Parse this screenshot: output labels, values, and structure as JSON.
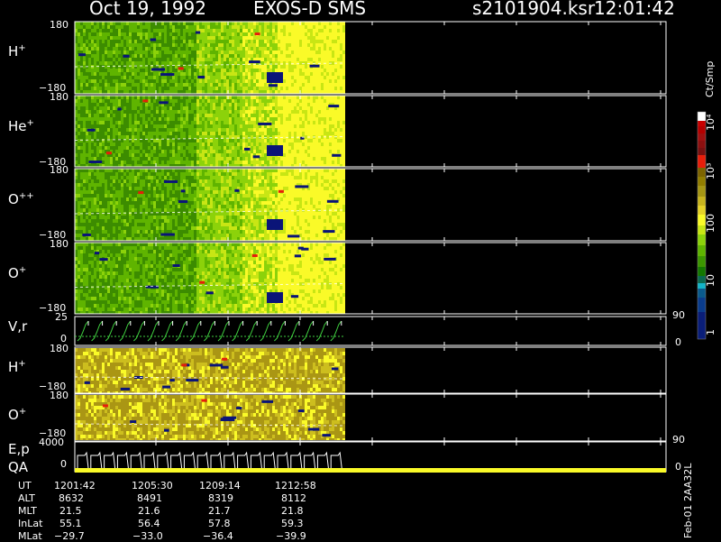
{
  "header": {
    "date": "Oct 19, 1992",
    "instrument": "EXOS-D SMS",
    "file": "s2101904.ksr",
    "time": "12:01:42"
  },
  "colorbar": {
    "unit": "Ct/Smp",
    "ticks": [
      "1",
      "10",
      "100",
      "10³",
      "10⁴"
    ]
  },
  "panels": [
    {
      "name": "H",
      "charge": "+",
      "ymax": "180",
      "ymin": "−180"
    },
    {
      "name": "He",
      "charge": "+",
      "ymax": "180",
      "ymin": "−180"
    },
    {
      "name": "O",
      "charge": "++",
      "ymax": "180",
      "ymin": "−180"
    },
    {
      "name": "O",
      "charge": "+",
      "ymax": "180",
      "ymin": "−180"
    }
  ],
  "vr_panel": {
    "label": "V,r",
    "ymax": "25",
    "ymin": "0",
    "right_top": "90",
    "right_bottom": "0"
  },
  "hist_panels": [
    {
      "name": "H",
      "charge": "+",
      "ymax": "180",
      "ymin": "−180"
    },
    {
      "name": "O",
      "charge": "+",
      "ymax": "180",
      "ymin": "−180"
    }
  ],
  "ep_panel": {
    "label1": "E,p",
    "label2": "QA",
    "ymax": "4000",
    "ymin": "0",
    "right_top": "90",
    "right_bottom": "0"
  },
  "orbit": {
    "rows": [
      {
        "label": "UT",
        "values": [
          "1201:42",
          "1205:30",
          "1209:14",
          "1212:58"
        ]
      },
      {
        "label": "ALT",
        "values": [
          "8632",
          "8491",
          "8319",
          "8112"
        ]
      },
      {
        "label": "MLT",
        "values": [
          "21.5",
          "21.6",
          "21.7",
          "21.8"
        ]
      },
      {
        "label": "InLat",
        "values": [
          "55.1",
          "56.4",
          "57.8",
          "59.3"
        ]
      },
      {
        "label": "MLat",
        "values": [
          "−29.7",
          "−33.0",
          "−36.4",
          "−39.9"
        ]
      }
    ]
  },
  "footer_id": "Feb-01 2AA32L",
  "chart_data": {
    "type": "heatmap",
    "title": "Oct 19, 1992   EXOS-D SMS",
    "xlabel": "UT",
    "x_ticks": [
      "1201:42",
      "1205:30",
      "1209:14",
      "1212:58"
    ],
    "ylim": [
      -180,
      180
    ],
    "color_scale": {
      "type": "log",
      "range": [
        1,
        10000
      ],
      "unit": "Ct/Smp"
    },
    "series": [
      {
        "name": "H+"
      },
      {
        "name": "He+"
      },
      {
        "name": "O++"
      },
      {
        "name": "O+"
      }
    ]
  },
  "palette": {
    "bg": "#000000",
    "line": "#ffffff",
    "green_dark": "#3c8c00",
    "green": "#5fb400",
    "green_light": "#8cd20a",
    "yellow_green": "#c8e614",
    "yellow": "#fafa28",
    "olive": "#aa9614",
    "olive_light": "#cdbe1e",
    "navy": "#0a1478",
    "red": "#e61e0a"
  }
}
